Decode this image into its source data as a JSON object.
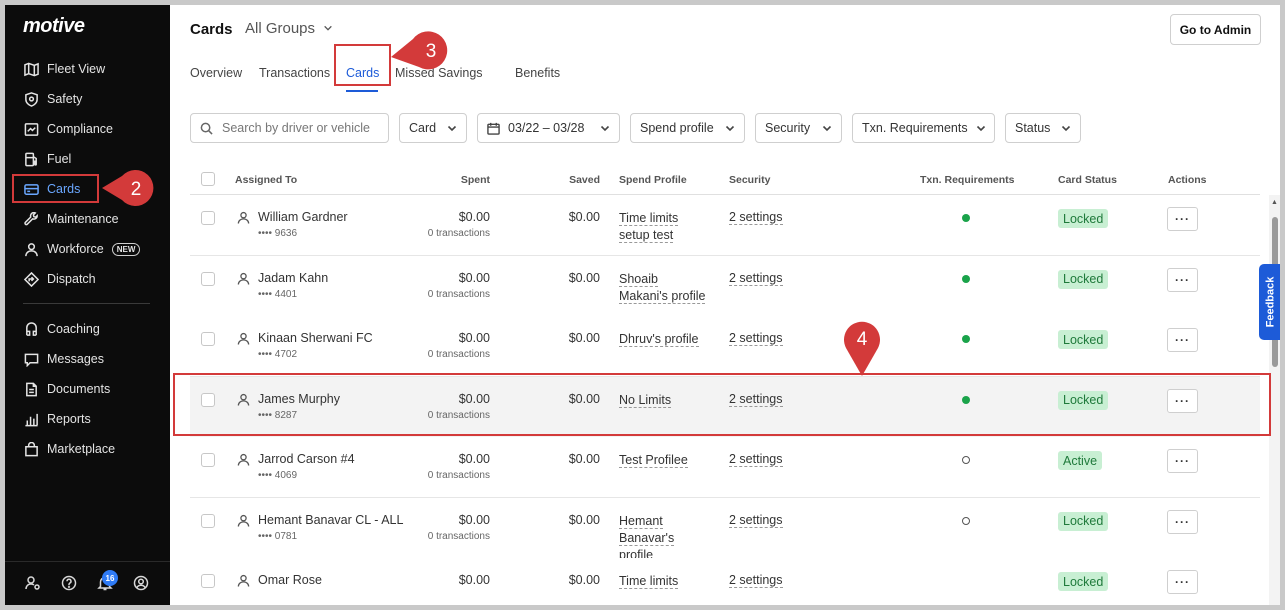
{
  "sidebar": {
    "logo": "motive",
    "items": [
      {
        "label": "Fleet View",
        "icon": "map-icon"
      },
      {
        "label": "Safety",
        "icon": "shield-icon"
      },
      {
        "label": "Compliance",
        "icon": "compliance-icon"
      },
      {
        "label": "Fuel",
        "icon": "fuel-icon"
      },
      {
        "label": "Cards",
        "icon": "card-icon",
        "active": true
      },
      {
        "label": "Maintenance",
        "icon": "wrench-icon"
      },
      {
        "label": "Workforce",
        "icon": "person-icon",
        "badge": "NEW"
      },
      {
        "label": "Dispatch",
        "icon": "dispatch-icon"
      },
      {
        "label": "Coaching",
        "icon": "coaching-icon"
      },
      {
        "label": "Messages",
        "icon": "message-icon"
      },
      {
        "label": "Documents",
        "icon": "document-icon"
      },
      {
        "label": "Reports",
        "icon": "reports-icon"
      },
      {
        "label": "Marketplace",
        "icon": "bag-icon"
      }
    ],
    "notification_count": "16"
  },
  "header": {
    "title": "Cards",
    "group": "All Groups",
    "admin_button": "Go to Admin"
  },
  "tabs": [
    "Overview",
    "Transactions",
    "Cards",
    "Missed Savings",
    "Benefits"
  ],
  "active_tab": "Cards",
  "filters": {
    "search_placeholder": "Search by driver or vehicle",
    "card": "Card",
    "date": "03/22 – 03/28",
    "spend_profile": "Spend profile",
    "security": "Security",
    "txn_requirements": "Txn. Requirements",
    "status": "Status"
  },
  "table": {
    "headers": {
      "assigned_to": "Assigned To",
      "spent": "Spent",
      "saved": "Saved",
      "spend_profile": "Spend Profile",
      "security": "Security",
      "txn_requirements": "Txn. Requirements",
      "card_status": "Card Status",
      "actions": "Actions"
    },
    "rows": [
      {
        "name": "William Gardner",
        "card": "•••• 9636",
        "spent": "$0.00",
        "txns": "0 transactions",
        "saved": "$0.00",
        "profile": [
          "Time limits",
          "setup test"
        ],
        "security": "2 settings",
        "txn_req": "filled",
        "status": "Locked",
        "action": "···"
      },
      {
        "name": "Jadam Kahn",
        "card": "•••• 4401",
        "spent": "$0.00",
        "txns": "0 transactions",
        "saved": "$0.00",
        "profile": [
          "Shoaib",
          "Makani's profile"
        ],
        "security": "2 settings",
        "txn_req": "filled",
        "status": "Locked",
        "action": "···"
      },
      {
        "name": "Kinaan Sherwani FC",
        "card": "•••• 4702",
        "spent": "$0.00",
        "txns": "0 transactions",
        "saved": "$0.00",
        "profile": [
          "Dhruv's profile"
        ],
        "security": "2 settings",
        "txn_req": "filled",
        "status": "Locked",
        "action": "···"
      },
      {
        "name": "James Murphy",
        "card": "•••• 8287",
        "spent": "$0.00",
        "txns": "0 transactions",
        "saved": "$0.00",
        "profile": [
          "No Limits"
        ],
        "security": "2 settings",
        "txn_req": "filled",
        "status": "Locked",
        "action": "···"
      },
      {
        "name": "Jarrod Carson #4",
        "card": "•••• 4069",
        "spent": "$0.00",
        "txns": "0 transactions",
        "saved": "$0.00",
        "profile": [
          "Test Profilee"
        ],
        "security": "2 settings",
        "txn_req": "empty",
        "status": "Active",
        "action": "···"
      },
      {
        "name": "Hemant Banavar CL - ALL",
        "card": "•••• 0781",
        "spent": "$0.00",
        "txns": "0 transactions",
        "saved": "$0.00",
        "profile": [
          "Hemant",
          "Banavar's",
          "profile"
        ],
        "security": "2 settings",
        "txn_req": "empty",
        "status": "Locked",
        "action": "···"
      },
      {
        "name": "Omar Rose",
        "card": "",
        "spent": "$0.00",
        "txns": "",
        "saved": "$0.00",
        "profile": [
          "Time limits"
        ],
        "security": "2 settings",
        "txn_req": "none",
        "status": "Locked",
        "action": "···"
      }
    ]
  },
  "feedback_label": "Feedback",
  "annotations": {
    "step2": "2",
    "step3": "3",
    "step4": "4",
    "color": "#d33a3a"
  }
}
